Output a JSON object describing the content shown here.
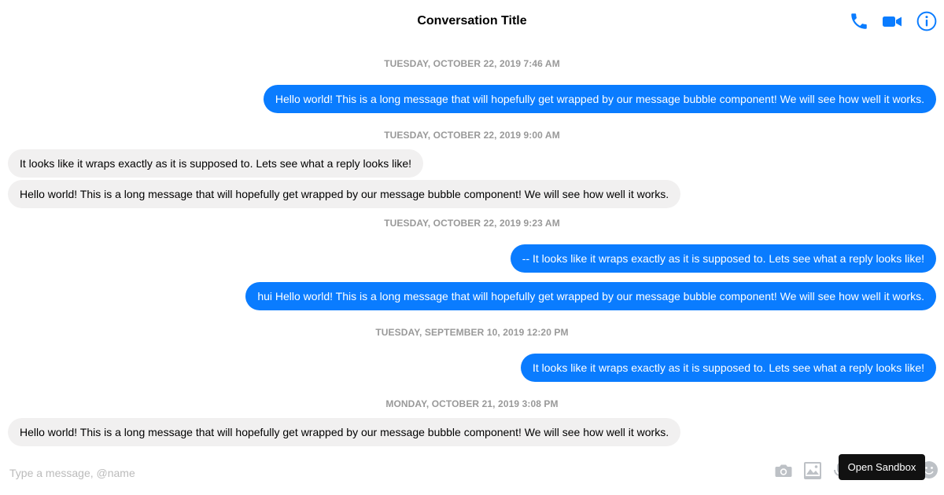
{
  "header": {
    "title": "Conversation Title",
    "accent_color": "#0a7cff",
    "icons": [
      "phone-icon",
      "video-camera-icon",
      "info-icon"
    ]
  },
  "messages": [
    {
      "type": "timestamp",
      "text": "TUESDAY, OCTOBER 22, 2019 7:46 AM"
    },
    {
      "type": "outgoing",
      "text": "Hello world! This is a long message that will hopefully get wrapped by our message bubble component! We will see how well it works."
    },
    {
      "type": "timestamp",
      "text": "TUESDAY, OCTOBER 22, 2019 9:00 AM"
    },
    {
      "type": "incoming",
      "text": "It looks like it wraps exactly as it is supposed to. Lets see what a reply looks like!"
    },
    {
      "type": "incoming",
      "text": "Hello world! This is a long message that will hopefully get wrapped by our message bubble component! We will see how well it works."
    },
    {
      "type": "timestamp",
      "text": "TUESDAY, OCTOBER 22, 2019 9:23 AM"
    },
    {
      "type": "outgoing",
      "text": "-- It looks like it wraps exactly as it is supposed to. Lets see what a reply looks like!"
    },
    {
      "type": "outgoing",
      "text": "hui Hello world! This is a long message that will hopefully get wrapped by our message bubble component! We will see how well it works."
    },
    {
      "type": "timestamp",
      "text": "TUESDAY, SEPTEMBER 10, 2019 12:20 PM"
    },
    {
      "type": "outgoing",
      "text": "It looks like it wraps exactly as it is supposed to. Lets see what a reply looks like!"
    },
    {
      "type": "timestamp",
      "text": "MONDAY, OCTOBER 21, 2019 3:08 PM"
    },
    {
      "type": "incoming",
      "text": "Hello world! This is a long message that will hopefully get wrapped by our message bubble component! We will see how well it works."
    }
  ],
  "composer": {
    "placeholder": "Type a message, @name",
    "value": "",
    "icons": [
      "camera-icon",
      "image-icon",
      "microphone-icon",
      "emoji-icon"
    ]
  },
  "sandbox": {
    "label": "Open Sandbox"
  },
  "colors": {
    "outgoing_bubble": "#0a7cff",
    "incoming_bubble": "#f1f0f0",
    "timestamp_text": "#999999"
  }
}
